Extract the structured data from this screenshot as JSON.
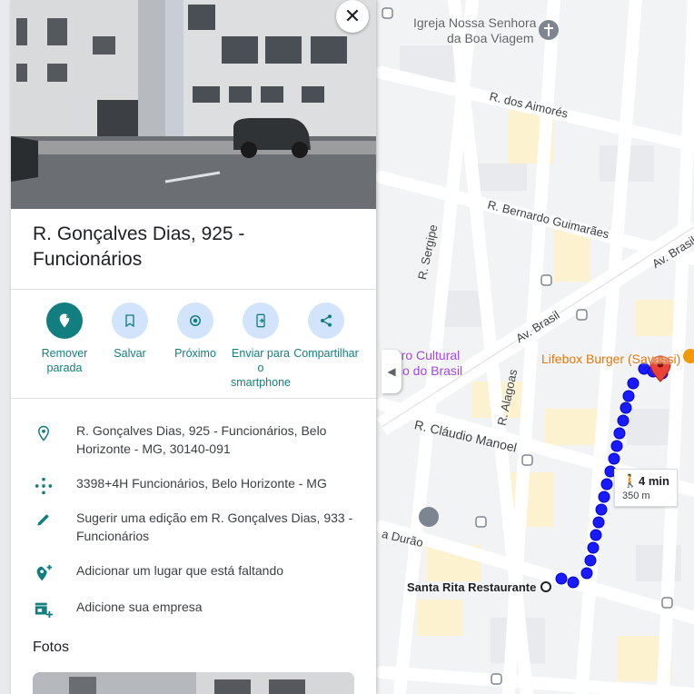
{
  "map": {
    "labels": {
      "church": "Igreja Nossa Senhora",
      "church2": "da Boa Viagem",
      "aimores": "R. dos Aimorés",
      "bernardo": "R. Bernardo Guimarães",
      "sergipe": "R. Sergipe",
      "brasil": "Av. Brasil",
      "brasil2": "Av. Brasil",
      "cultural1": "ntro Cultural",
      "cultural2": "co do Brasil",
      "lifebox": "Lifebox Burger (Savassi)",
      "alagoas": "R. Alagoas",
      "claudio": "R. Cláudio Manoel",
      "durao": "a Durão",
      "santarita": "Santa Rita Restaurante"
    },
    "eta": {
      "time": "4 min",
      "distance": "350 m"
    }
  },
  "panel": {
    "title": "R. Gonçalves Dias, 925 - Funcionários",
    "actions": [
      {
        "label": "Remover parada",
        "icon": "remove-stop-icon"
      },
      {
        "label": "Salvar",
        "icon": "bookmark-icon"
      },
      {
        "label": "Próximo",
        "icon": "nearby-icon"
      },
      {
        "label": "Enviar para o smartphone",
        "icon": "send-to-phone-icon"
      },
      {
        "label": "Compartilhar",
        "icon": "share-icon"
      }
    ],
    "info": [
      {
        "text": "R. Gonçalves Dias, 925 - Funcionários, Belo Horizonte - MG, 30140-091",
        "icon": "location-pin-icon"
      },
      {
        "text": "3398+4H Funcionários, Belo Horizonte - MG",
        "icon": "plus-code-icon"
      },
      {
        "text": "Sugerir uma edição em R. Gonçalves Dias, 933 - Funcionários",
        "icon": "pencil-icon"
      },
      {
        "text": "Adicionar um lugar que está faltando",
        "icon": "add-place-icon"
      },
      {
        "text": "Adicione sua empresa",
        "icon": "add-business-icon"
      }
    ],
    "photos_title": "Fotos"
  },
  "colors": {
    "accent": "#137e80",
    "route": "#1a1aff",
    "pin": "#ea4335"
  }
}
